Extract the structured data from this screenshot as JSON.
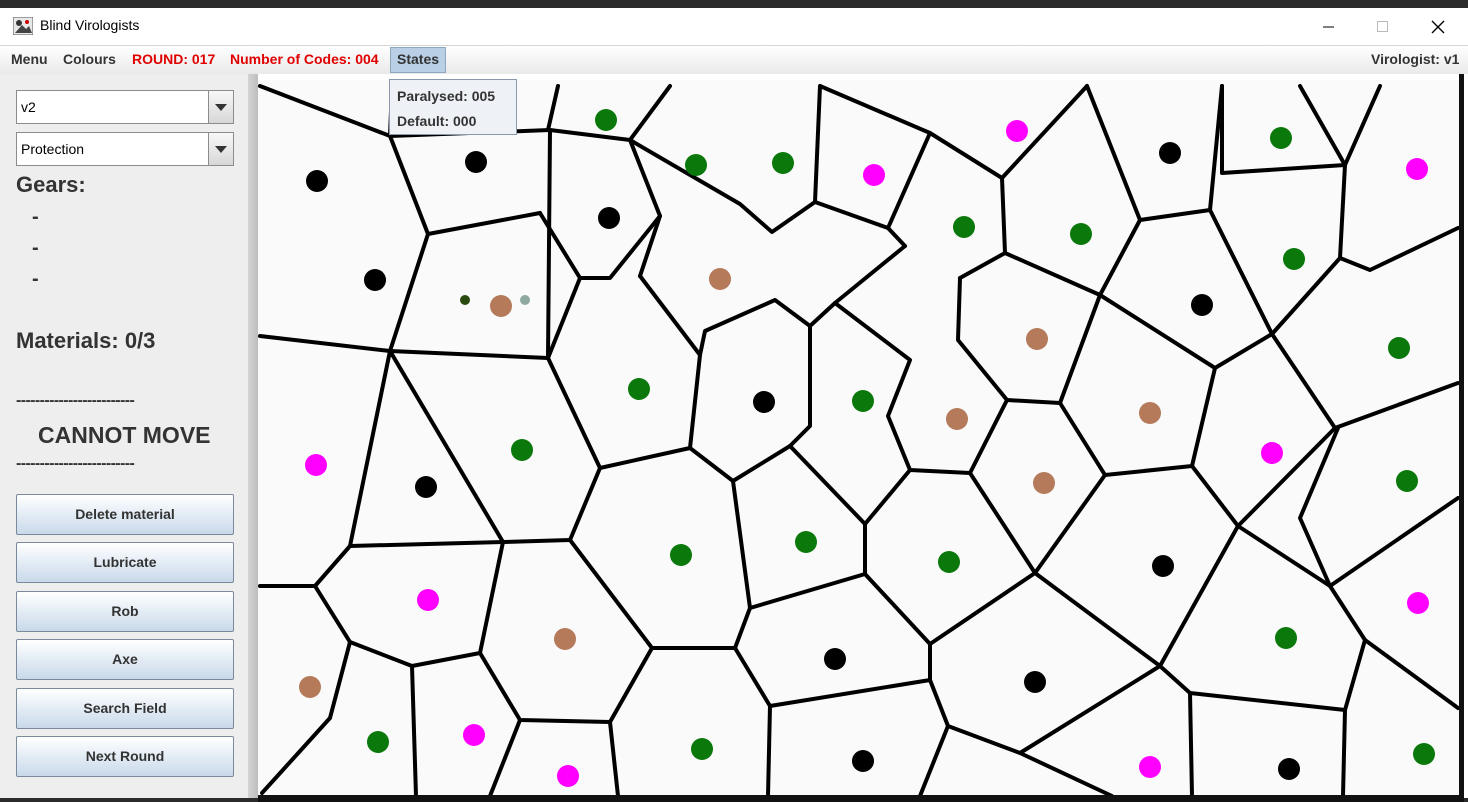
{
  "window": {
    "title": "Blind Virologists"
  },
  "menubar": {
    "menu": "Menu",
    "colours": "Colours",
    "round": "ROUND: 017",
    "codes": "Number of Codes: 004",
    "states": "States",
    "virologist": "Virologist: v1"
  },
  "states_popup": {
    "paralysed": "Paralysed: 005",
    "default": "Default: 000"
  },
  "sidebar": {
    "virologist_select": "v2",
    "action_select": "Protection",
    "gears_label": "Gears:",
    "gears": [
      "-",
      "-",
      "-"
    ],
    "materials_label": "Materials: 0/3",
    "separator": "-------------------------",
    "move_status": "CANNOT MOVE",
    "buttons": [
      "Delete material",
      "Lubricate",
      "Rob",
      "Axe",
      "Search Field",
      "Next Round"
    ]
  },
  "colors": {
    "green": "#0a780a",
    "black": "#000000",
    "magenta": "#ff00ff",
    "brown": "#b47a5a",
    "warning": "#e00000",
    "board_bg": "#fafafa"
  },
  "board": {
    "edges": [
      [
        1,
        2
      ],
      [
        2,
        3
      ],
      [
        3,
        4
      ],
      [
        4,
        5
      ],
      [
        5,
        6
      ],
      [
        6,
        7
      ],
      [
        7,
        8
      ],
      [
        8,
        9
      ],
      [
        9,
        10
      ],
      [
        10,
        11
      ],
      [
        11,
        12
      ],
      [
        13,
        14
      ],
      [
        14,
        15
      ],
      [
        15,
        16
      ],
      [
        16,
        17
      ],
      [
        17,
        18
      ],
      [
        18,
        19
      ],
      [
        19,
        12
      ],
      [
        1,
        20
      ],
      [
        20,
        21
      ],
      [
        21,
        22
      ],
      [
        22,
        23
      ],
      [
        23,
        24
      ],
      [
        24,
        25
      ],
      [
        25,
        26
      ],
      [
        26,
        27
      ],
      [
        27,
        28
      ],
      [
        28,
        29
      ],
      [
        29,
        30
      ],
      [
        30,
        31
      ],
      [
        31,
        32
      ],
      [
        3,
        23
      ],
      [
        4,
        33
      ],
      [
        33,
        34
      ],
      [
        34,
        35
      ],
      [
        35,
        36
      ],
      [
        36,
        37
      ],
      [
        37,
        6
      ],
      [
        6,
        38
      ],
      [
        38,
        39
      ],
      [
        7,
        39
      ],
      [
        39,
        40
      ],
      [
        40,
        14
      ],
      [
        14,
        41
      ],
      [
        41,
        42
      ],
      [
        42,
        43
      ],
      [
        43,
        27
      ],
      [
        40,
        44
      ],
      [
        44,
        28
      ],
      [
        9,
        45
      ],
      [
        45,
        46
      ],
      [
        46,
        47
      ],
      [
        47,
        16
      ],
      [
        17,
        48
      ],
      [
        48,
        47
      ],
      [
        46,
        49
      ],
      [
        49,
        50
      ],
      [
        50,
        51
      ],
      [
        51,
        18
      ],
      [
        11,
        52
      ],
      [
        52,
        19
      ],
      [
        52,
        53
      ],
      [
        53,
        54
      ],
      [
        54,
        55
      ],
      [
        55,
        56
      ],
      [
        56,
        57
      ],
      [
        57,
        58
      ],
      [
        21,
        59
      ],
      [
        59,
        60
      ],
      [
        60,
        61
      ],
      [
        61,
        62
      ],
      [
        62,
        63
      ],
      [
        63,
        64
      ],
      [
        64,
        65
      ],
      [
        65,
        66
      ],
      [
        66,
        67
      ],
      [
        67,
        68
      ],
      [
        68,
        69
      ],
      [
        69,
        70
      ],
      [
        70,
        71
      ],
      [
        59,
        72
      ],
      [
        72,
        73
      ],
      [
        73,
        74
      ],
      [
        22,
        75
      ],
      [
        75,
        76
      ],
      [
        76,
        77
      ],
      [
        77,
        78
      ],
      [
        78,
        79
      ],
      [
        79,
        80
      ],
      [
        80,
        81
      ],
      [
        81,
        82
      ],
      [
        82,
        83
      ],
      [
        83,
        84
      ],
      [
        84,
        85
      ],
      [
        85,
        86
      ],
      [
        24,
        87
      ],
      [
        87,
        88
      ],
      [
        88,
        89
      ],
      [
        89,
        90
      ],
      [
        90,
        91
      ],
      [
        91,
        92
      ],
      [
        92,
        93
      ],
      [
        93,
        94
      ],
      [
        94,
        95
      ],
      [
        41,
        96
      ],
      [
        96,
        97
      ],
      [
        97,
        98
      ],
      [
        98,
        99
      ],
      [
        99,
        100
      ],
      [
        100,
        101
      ],
      [
        42,
        102
      ],
      [
        102,
        103
      ],
      [
        103,
        104
      ],
      [
        104,
        105
      ],
      [
        105,
        106
      ],
      [
        106,
        107
      ],
      [
        34,
        108
      ],
      [
        108,
        109
      ],
      [
        109,
        110
      ],
      [
        110,
        111
      ],
      [
        111,
        112
      ],
      [
        112,
        113
      ],
      [
        113,
        114
      ],
      [
        36,
        115
      ],
      [
        115,
        116
      ],
      [
        116,
        117
      ],
      [
        117,
        118
      ],
      [
        118,
        119
      ],
      [
        119,
        120
      ],
      [
        120,
        121
      ],
      [
        50,
        122
      ],
      [
        122,
        123
      ],
      [
        123,
        124
      ],
      [
        124,
        125
      ],
      [
        125,
        126
      ],
      [
        126,
        127
      ],
      [
        127,
        128
      ],
      [
        128,
        129
      ],
      [
        54,
        130
      ],
      [
        130,
        131
      ],
      [
        131,
        132
      ],
      [
        132,
        133
      ],
      [
        133,
        134
      ],
      [
        134,
        135
      ],
      [
        56,
        136
      ],
      [
        136,
        137
      ],
      [
        137,
        138
      ],
      [
        138,
        139
      ],
      [
        139,
        140
      ],
      [
        140,
        141
      ],
      [
        57,
        142
      ],
      [
        142,
        143
      ],
      [
        143,
        144
      ],
      [
        144,
        145
      ],
      [
        145,
        146
      ],
      [
        60,
        147
      ],
      [
        147,
        148
      ],
      [
        148,
        149
      ],
      [
        149,
        150
      ],
      [
        150,
        151
      ],
      [
        151,
        152
      ],
      [
        61,
        153
      ],
      [
        153,
        154
      ],
      [
        154,
        155
      ],
      [
        155,
        156
      ],
      [
        62,
        157
      ],
      [
        157,
        158
      ],
      [
        158,
        159
      ],
      [
        159,
        160
      ],
      [
        160,
        161
      ],
      [
        63,
        162
      ],
      [
        162,
        163
      ],
      [
        163,
        164
      ],
      [
        164,
        165
      ],
      [
        64,
        166
      ],
      [
        166,
        167
      ],
      [
        167,
        168
      ],
      [
        168,
        169
      ],
      [
        169,
        170
      ],
      [
        65,
        171
      ],
      [
        171,
        172
      ],
      [
        172,
        173
      ],
      [
        173,
        174
      ],
      [
        66,
        175
      ],
      [
        175,
        176
      ],
      [
        176,
        177
      ],
      [
        177,
        178
      ],
      [
        67,
        179
      ],
      [
        179,
        180
      ],
      [
        180,
        181
      ],
      [
        181,
        182
      ],
      [
        68,
        183
      ],
      [
        183,
        184
      ],
      [
        184,
        185
      ],
      [
        185,
        186
      ],
      [
        69,
        187
      ],
      [
        187,
        188
      ],
      [
        188,
        189
      ],
      [
        189,
        190
      ]
    ]
  },
  "viruses": [
    {
      "color": "green",
      "col": 6,
      "row": 1
    },
    {
      "color": "green",
      "col": 8,
      "row": 2
    },
    {
      "color": "green",
      "col": 10,
      "row": 2
    },
    {
      "color": "green",
      "col": 14,
      "row": 4
    },
    {
      "color": "green",
      "col": 17,
      "row": 4
    },
    {
      "color": "green",
      "col": 21,
      "row": 2
    },
    {
      "color": "green",
      "col": 21,
      "row": 5
    },
    {
      "color": "green",
      "col": 23,
      "row": 7
    }
  ]
}
